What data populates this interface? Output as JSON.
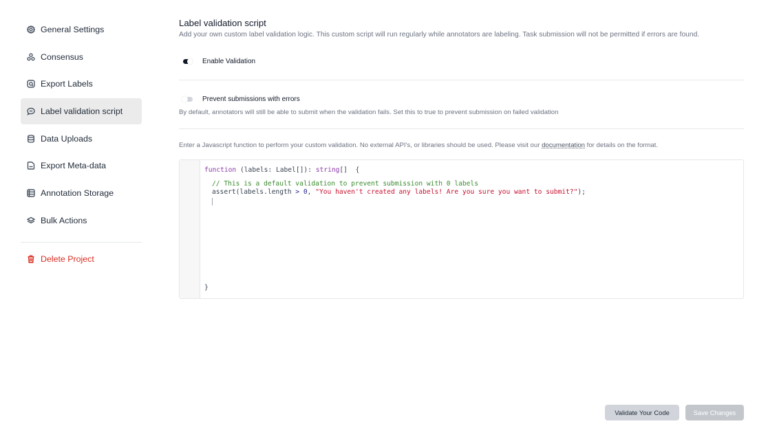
{
  "sidebar": {
    "items": [
      {
        "label": "General Settings",
        "icon": "gear-icon"
      },
      {
        "label": "Consensus",
        "icon": "users-icon"
      },
      {
        "label": "Export Labels",
        "icon": "export-labels-icon"
      },
      {
        "label": "Label validation script",
        "icon": "chat-bubble-icon",
        "active": true
      },
      {
        "label": "Data Uploads",
        "icon": "database-icon"
      },
      {
        "label": "Export Meta-data",
        "icon": "document-icon"
      },
      {
        "label": "Annotation Storage",
        "icon": "storage-icon"
      },
      {
        "label": "Bulk Actions",
        "icon": "layers-icon"
      }
    ],
    "delete_label": "Delete Project",
    "delete_color": "#d92d20"
  },
  "main": {
    "title": "Label validation script",
    "subtitle": "Add your own custom label validation logic. This custom script will run regularly while annotators are labeling. Task submission will not be permitted if errors are found.",
    "enable_validation": {
      "label": "Enable Validation",
      "state": "on"
    },
    "prevent_submissions": {
      "label": "Prevent submissions with errors",
      "state": "off",
      "description": "By default, annotators will still be able to submit when the validation fails. Set this to true to prevent submission on failed validation"
    },
    "help": {
      "before": "Enter a Javascript function to perform your custom validation. No external API's, or libraries should be used. Please visit our ",
      "link": "documentation",
      "after": " for details on the format."
    }
  },
  "editor": {
    "kw_function": "function",
    "sig_params": " (labels: Label",
    "sig_bracket1": "[]",
    "sig_close": "): ",
    "kw_string": "string",
    "sig_bracket2": "[]",
    "sig_brace": "  {",
    "comment": "// This is a default validation to prevent submission with 0 labels",
    "assert_prefix": "assert(labels.length ",
    "assert_op": ">",
    "assert_space": " ",
    "assert_num": "0",
    "assert_comma": ", ",
    "assert_string": "\"You haven't created any labels! Are you sure you want to submit?\"",
    "assert_suffix": ");",
    "closing_brace": "}"
  },
  "footer": {
    "validate_label": "Validate Your Code",
    "save_label": "Save Changes"
  }
}
